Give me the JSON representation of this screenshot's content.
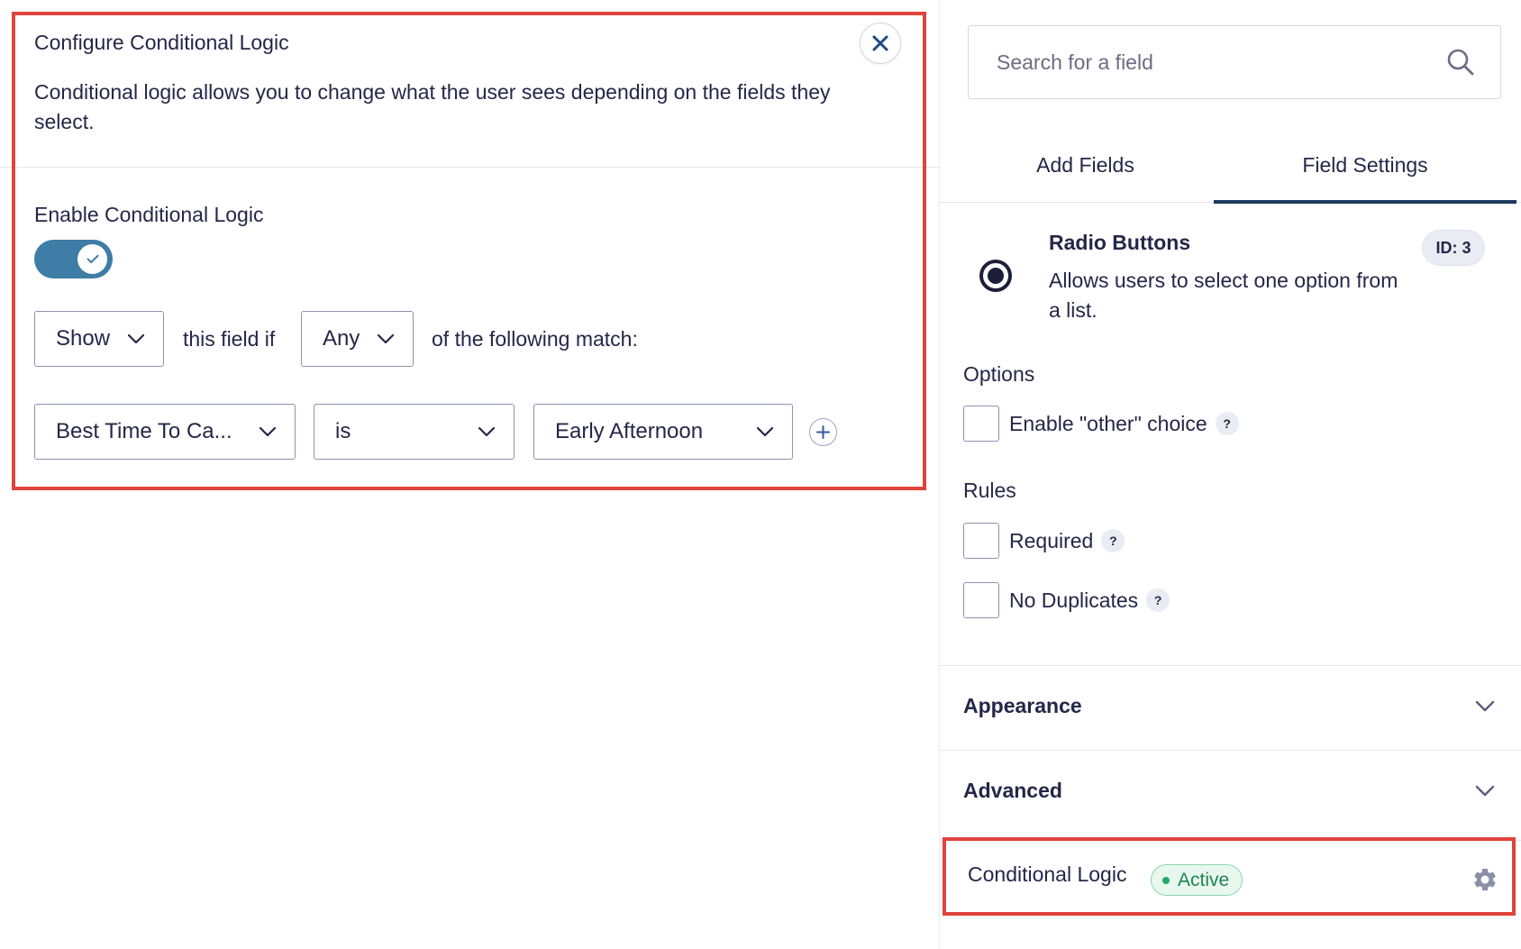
{
  "conditional_logic_panel": {
    "title": "Configure Conditional Logic",
    "description": "Conditional logic allows you to change what the user sees depending on the fields they select.",
    "close_icon": "close-icon",
    "enable_label": "Enable Conditional Logic",
    "enabled": true,
    "action_select": "Show",
    "text_this_field_if": "this field if",
    "match_select": "Any",
    "text_following_match": "of the following match:",
    "rule": {
      "field": "Best Time To Ca...",
      "operator": "is",
      "value": "Early Afternoon"
    },
    "add_rule_icon": "plus-circle-icon"
  },
  "sidebar": {
    "search": {
      "placeholder": "Search for a field",
      "value": ""
    },
    "tabs": [
      {
        "label": "Add Fields",
        "active": false
      },
      {
        "label": "Field Settings",
        "active": true
      }
    ],
    "field": {
      "icon": "radio-button-icon",
      "title": "Radio Buttons",
      "description": "Allows users to select one option from a list.",
      "id_badge": "ID: 3"
    },
    "options": {
      "label": "Options",
      "items": [
        {
          "label": "Enable \"other\" choice",
          "checked": false,
          "help": "?"
        }
      ]
    },
    "rules": {
      "label": "Rules",
      "items": [
        {
          "label": "Required",
          "checked": false,
          "help": "?"
        },
        {
          "label": "No Duplicates",
          "checked": false,
          "help": "?"
        }
      ]
    },
    "accordions": [
      {
        "label": "Appearance"
      },
      {
        "label": "Advanced"
      }
    ],
    "conditional_logic": {
      "label": "Conditional Logic",
      "status": "Active",
      "icon": "gear-icon"
    }
  },
  "colors": {
    "toggle_on": "#3e7da6",
    "tab_active_underline": "#1c3a5e",
    "highlight_outline": "#e0433b",
    "active_badge_text": "#1d8553",
    "active_badge_bg": "#e8f8ef"
  }
}
